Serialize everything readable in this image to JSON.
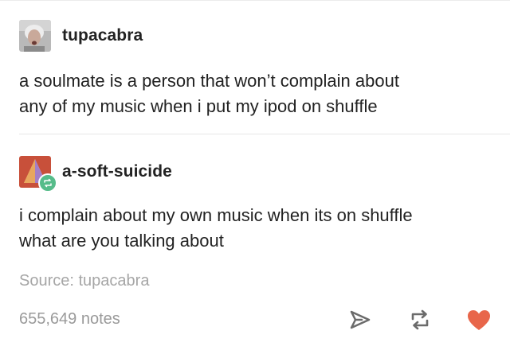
{
  "post": {
    "original": {
      "username": "tupacabra",
      "text": "a soulmate is a person that won’t complain about\nany of my music when i put my ipod on shuffle"
    },
    "reblog": {
      "username": "a-soft-suicide",
      "text": "i complain about my own music when its on shuffle\nwhat are you talking about"
    },
    "source": "Source: tupacabra",
    "notes": "655,649 notes"
  },
  "icons": {
    "share": "paper-plane-icon",
    "reblog": "reblog-icon",
    "like": "heart-icon"
  },
  "colors": {
    "heart": "#e8664a",
    "reblog_badge": "#56bc8a",
    "text": "#222222",
    "muted": "#a6a6a6"
  }
}
